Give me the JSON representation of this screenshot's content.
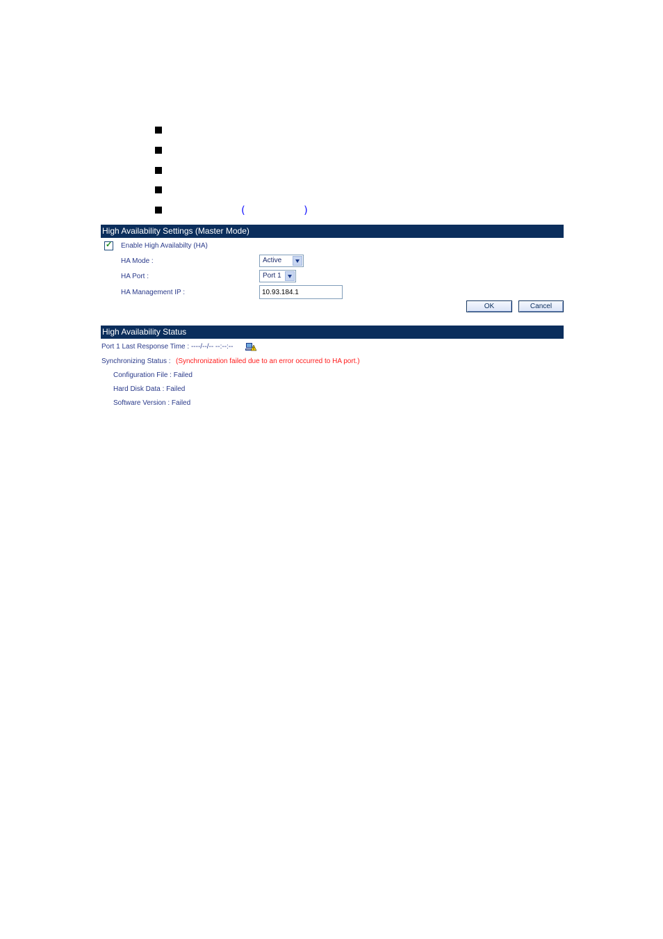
{
  "bullets": {
    "count": 5,
    "paren_left": "(",
    "paren_right": ")"
  },
  "settings": {
    "title": "High Availability Settings (Master Mode)",
    "enable_label": "Enable High Availabilty (HA)",
    "enable_checked": true,
    "mode_label": "HA Mode :",
    "mode_value": "Active",
    "port_label": "HA Port :",
    "port_value": "Port 1",
    "mgmt_ip_label": "HA Management IP :",
    "mgmt_ip_value": "10.93.184.1",
    "ok_label": "OK",
    "cancel_label": "Cancel"
  },
  "status": {
    "title": "High Availability Status",
    "last_response": "Port 1 Last Response Time : ----/--/-- --:--:--",
    "sync_label": "Synchronizing Status :",
    "sync_error": "(Synchronization failed due to an error occurred to HA port.)",
    "config_file": "Configuration File : Failed",
    "hard_disk": "Hard Disk Data : Failed",
    "software_version": "Software Version : Failed"
  },
  "colors": {
    "header_bar": "#0b2e5c",
    "label_text": "#2a3a8a",
    "error_text": "#ff1a1a"
  }
}
